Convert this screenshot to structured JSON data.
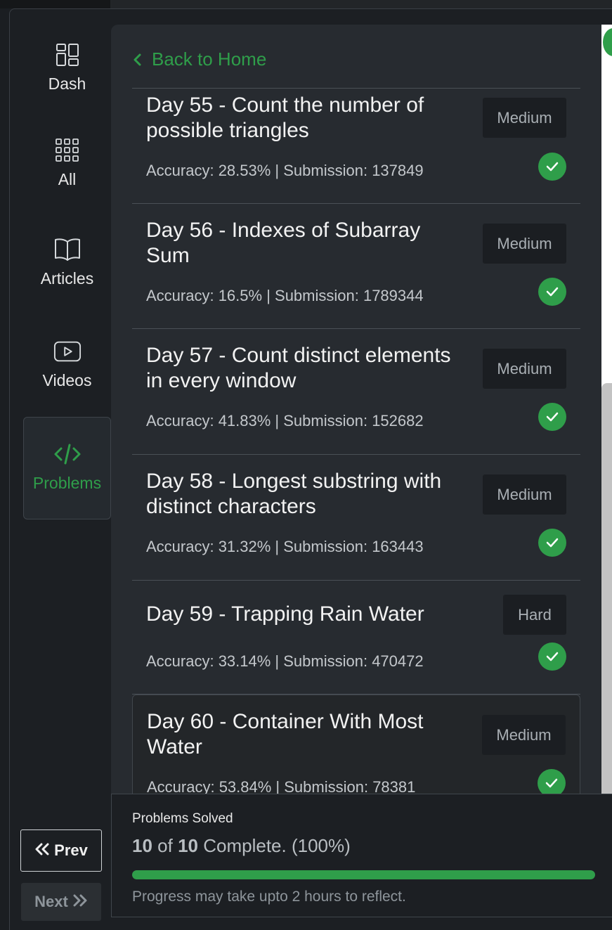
{
  "sidebar": {
    "items": [
      {
        "label": "Dash",
        "icon": "dashboard-icon"
      },
      {
        "label": "All",
        "icon": "grid-icon"
      },
      {
        "label": "Articles",
        "icon": "book-icon"
      },
      {
        "label": "Videos",
        "icon": "video-icon"
      },
      {
        "label": "Problems",
        "icon": "code-icon",
        "active": true
      }
    ],
    "prev_label": "Prev",
    "next_label": "Next"
  },
  "main": {
    "back_label": "Back to Home",
    "problems": [
      {
        "title": "Day 55 - Count the number of possible triangles",
        "difficulty": "Medium",
        "meta": "Accuracy: 28.53% | Submission: 137849",
        "solved": true
      },
      {
        "title": "Day 56 - Indexes of Subarray Sum",
        "difficulty": "Medium",
        "meta": "Accuracy: 16.5% | Submission: 1789344",
        "solved": true
      },
      {
        "title": "Day 57 - Count distinct elements in every window",
        "difficulty": "Medium",
        "meta": "Accuracy: 41.83% | Submission: 152682",
        "solved": true
      },
      {
        "title": "Day 58 - Longest substring with distinct characters",
        "difficulty": "Medium",
        "meta": "Accuracy: 31.32% | Submission: 163443",
        "solved": true
      },
      {
        "title": "Day 59 - Trapping Rain Water",
        "difficulty": "Hard",
        "meta": "Accuracy: 33.14% | Submission: 470472",
        "solved": true
      },
      {
        "title": "Day 60 - Container With Most Water",
        "difficulty": "Medium",
        "meta": "Accuracy: 53.84% | Submission: 78381",
        "solved": true
      }
    ]
  },
  "progress": {
    "title": "Problems Solved",
    "solved": "10",
    "of_word": "of",
    "total": "10",
    "complete_text": "Complete. (100%)",
    "fraction": 1.0,
    "note": "Progress may take upto 2 hours to reflect."
  },
  "colors": {
    "accent": "#2f9e4a",
    "panel": "#272b30",
    "background": "#1c1f23"
  }
}
